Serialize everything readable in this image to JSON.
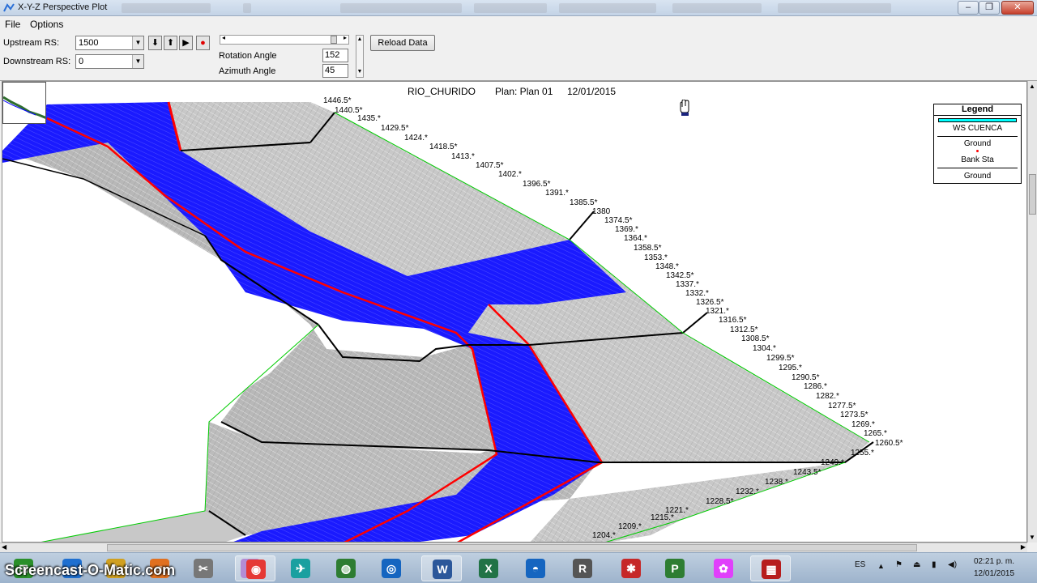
{
  "window": {
    "title": "X-Y-Z Perspective Plot"
  },
  "menu": {
    "items": [
      "File",
      "Options"
    ]
  },
  "controls": {
    "upstream_label": "Upstream RS:",
    "upstream_value": "1500",
    "downstream_label": "Downstream RS:",
    "downstream_value": "0",
    "rotation_label": "Rotation Angle",
    "rotation_value": "152",
    "azimuth_label": "Azimuth Angle",
    "azimuth_value": "45",
    "reload_label": "Reload Data"
  },
  "plot": {
    "title": "RIO_CHURIDO",
    "plan": "Plan: Plan 01",
    "date": "12/01/2015",
    "colors": {
      "water": "#1a1aff",
      "bank_line": "#ff0000",
      "ground": "#c8c8c8",
      "outline": "#000000",
      "edge": "#00cc00"
    },
    "station_labels": [
      "1446.5*",
      "1440.5*",
      "1435.*",
      "1429.5*",
      "1424.*",
      "1418.5*",
      "1413.*",
      "1407.5*",
      "1402.*",
      "1396.5*",
      "1391.*",
      "1385.5*",
      "1380",
      "1374.5*",
      "1369.*",
      "1364.*",
      "1358.5*",
      "1353.*",
      "1348.*",
      "1342.5*",
      "1337.*",
      "1332.*",
      "1326.5*",
      "1321.*",
      "1316.5*",
      "1312.5*",
      "1308.5*",
      "1304.*",
      "1299.5*",
      "1295.*",
      "1290.5*",
      "1286.*",
      "1282.*",
      "1277.5*",
      "1273.5*",
      "1269.*",
      "1265.*",
      "1260.5*",
      "1255.*",
      "1249.*",
      "1243.5*",
      "1238.*",
      "1232.*",
      "1228.5*",
      "1221.*",
      "1215.*",
      "1209.*",
      "1204.*"
    ]
  },
  "legend": {
    "title": "Legend",
    "items": [
      "WS CUENCA",
      "Ground",
      "Bank Sta",
      "Ground"
    ],
    "ws_color": "#00ffff",
    "bank_color": "#ff0000"
  },
  "taskbar": {
    "apps": [
      "start-orb",
      "ie-icon",
      "sketch-icon",
      "calc-icon",
      "edit-icon",
      "paint-icon",
      "chrome-icon",
      "hec-icon",
      "globe-icon",
      "search-globe-icon",
      "word-icon",
      "excel-icon",
      "earth-icon",
      "ras-icon",
      "star-icon",
      "publisher-icon",
      "flower-icon",
      "screencast-icon"
    ],
    "lang": "ES",
    "time": "02:21 p. m.",
    "date": "12/01/2015"
  },
  "watermark": "Screencast-O-Matic.com"
}
